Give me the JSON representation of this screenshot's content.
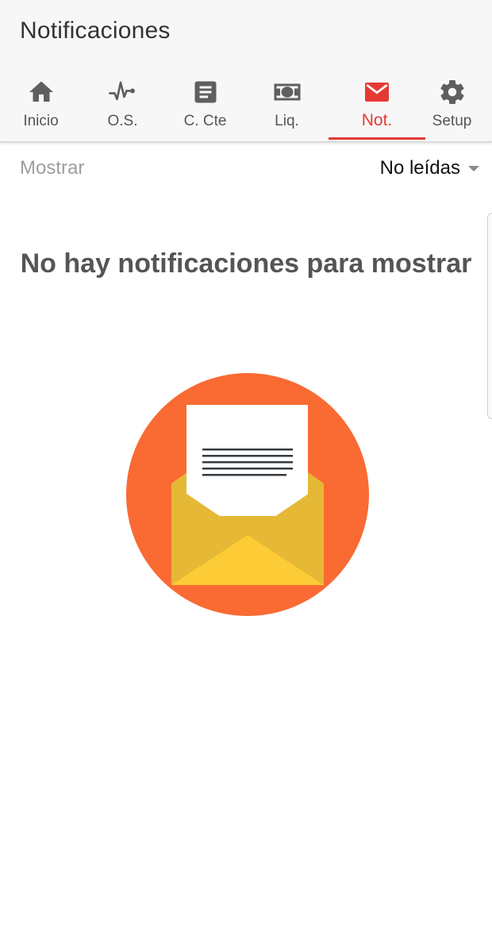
{
  "header": {
    "title": "Notificaciones"
  },
  "tabs": [
    {
      "label": "Inicio",
      "icon": "home-icon",
      "active": false
    },
    {
      "label": "O.S.",
      "icon": "pulse-icon",
      "active": false
    },
    {
      "label": "C. Cte",
      "icon": "document-icon",
      "active": false
    },
    {
      "label": "Liq.",
      "icon": "money-icon",
      "active": false
    },
    {
      "label": "Not.",
      "icon": "mail-icon",
      "active": true
    },
    {
      "label": "Setup",
      "icon": "gear-icon",
      "active": false
    }
  ],
  "filter": {
    "label": "Mostrar",
    "selected": "No leídas"
  },
  "empty_state": {
    "message": "No hay notificaciones para mostrar",
    "illustration": "open-envelope-icon"
  },
  "colors": {
    "accent": "#e53935",
    "icon_gray": "#5f5f5f",
    "circle": "#fa6a33",
    "envelope_dark": "#e5b935",
    "envelope_light": "#fdcb35"
  }
}
